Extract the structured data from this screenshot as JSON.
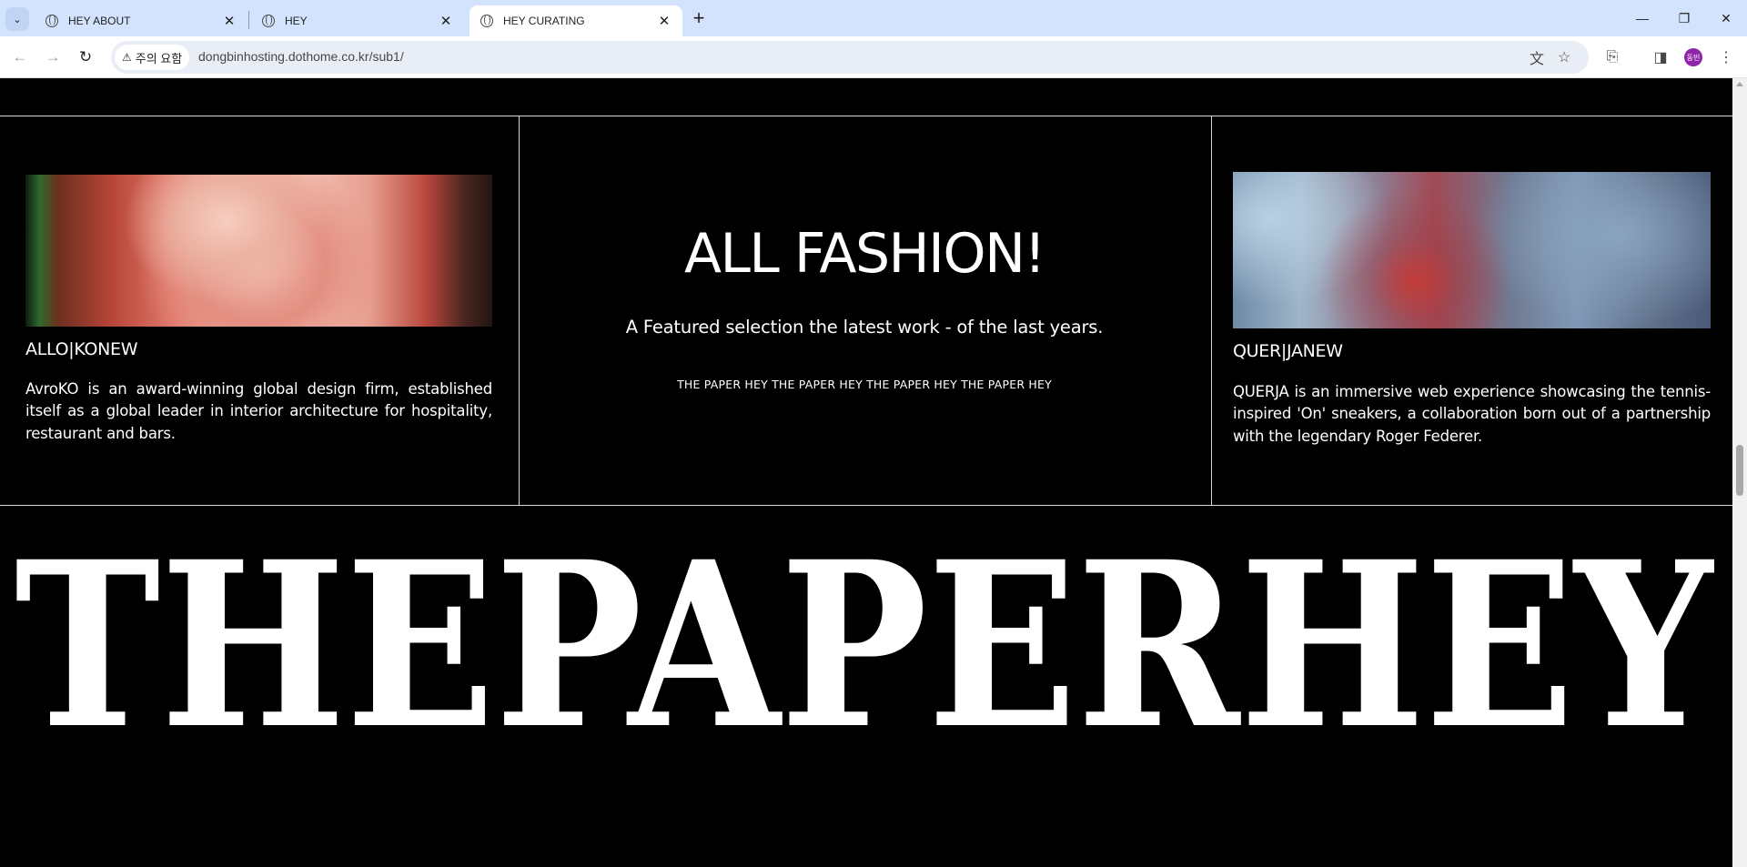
{
  "browser": {
    "tabs": [
      {
        "title": "HEY ABOUT",
        "active": false
      },
      {
        "title": "HEY",
        "active": false
      },
      {
        "title": "HEY CURATING",
        "active": true
      }
    ],
    "security_chip": "주의 요함",
    "url": "dongbinhosting.dothome.co.kr/sub1/",
    "profile_initials": "동빈"
  },
  "cards": {
    "left": {
      "title": "ALLO|KONEW",
      "text": "AvroKO is an award-winning global design firm, established itself as a global leader in interior architecture for hospitality, restaurant and bars."
    },
    "center": {
      "title": "ALL FASHION!",
      "subtitle": "A Featured selection the latest work - of the last years.",
      "marquee": "THE PAPER HEY THE PAPER HEY THE PAPER HEY THE PAPER HEY"
    },
    "right": {
      "title": "QUER|JANEW",
      "text": "QUERJA is an immersive web experience showcasing the tennis-inspired 'On' sneakers, a collaboration born out of a partnership with the legendary Roger Federer."
    }
  },
  "wordmark": "THEPAPERHEY"
}
